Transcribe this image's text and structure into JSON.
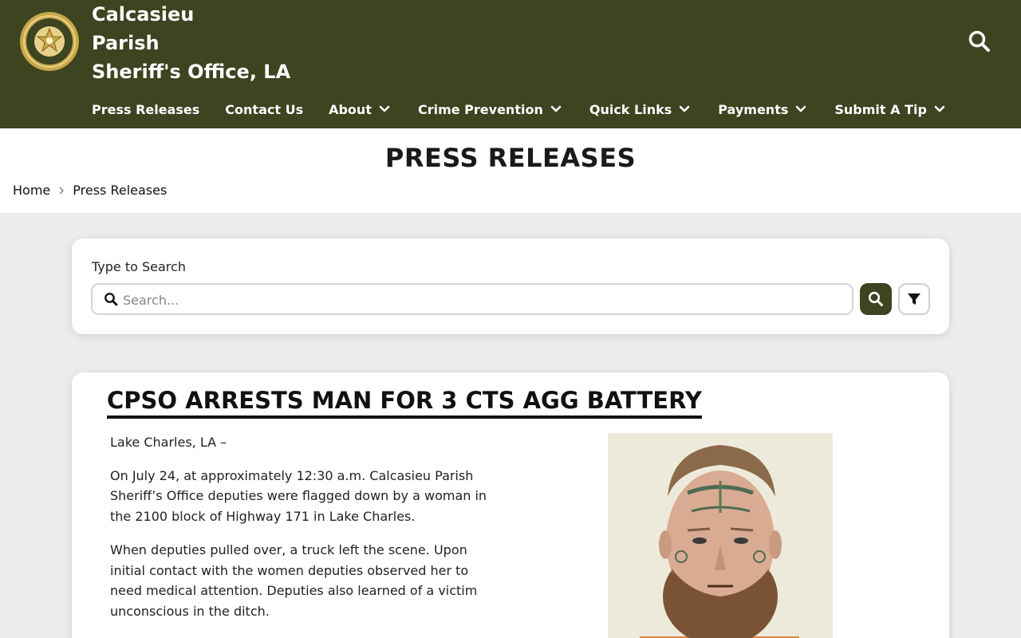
{
  "header": {
    "title_lines": [
      "Calcasieu",
      "Parish",
      "Sheriff's Office, LA"
    ],
    "logo_icon": "sheriff-badge-icon",
    "search_icon": "search-icon"
  },
  "nav": {
    "items": [
      {
        "label": "Press Releases",
        "has_dropdown": false
      },
      {
        "label": "Contact Us",
        "has_dropdown": false
      },
      {
        "label": "About",
        "has_dropdown": true
      },
      {
        "label": "Crime Prevention",
        "has_dropdown": true
      },
      {
        "label": "Quick Links",
        "has_dropdown": true
      },
      {
        "label": "Payments",
        "has_dropdown": true
      },
      {
        "label": "Submit A Tip",
        "has_dropdown": true
      }
    ]
  },
  "page": {
    "title": "PRESS RELEASES",
    "breadcrumb": [
      "Home",
      "Press Releases"
    ]
  },
  "search": {
    "label": "Type to Search",
    "placeholder": "Search...",
    "value": ""
  },
  "article": {
    "title": "CPSO ARRESTS MAN FOR 3 CTS AGG BATTERY",
    "paragraphs": [
      "Lake Charles, LA –",
      "On July 24, at approximately 12:30 a.m. Calcasieu Parish Sheriff’s Office deputies were flagged down by a woman in the 2100 block of Highway 171 in Lake Charles.",
      "When deputies pulled over, a truck left the scene.  Upon initial contact with the women deputies observed her to need medical attention.  Deputies also learned of a victim unconscious in the ditch."
    ]
  },
  "colors": {
    "brand": "#3c4420",
    "page_bg": "#ececec",
    "card_bg": "#ffffff"
  }
}
